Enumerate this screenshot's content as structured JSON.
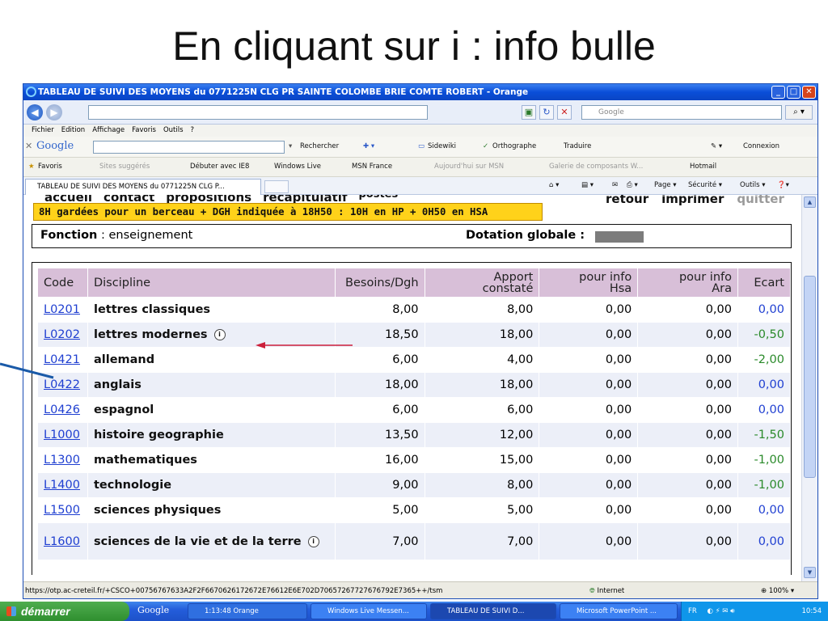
{
  "slide": {
    "title": "En cliquant sur i : info bulle"
  },
  "window": {
    "title": "TABLEAU DE SUIVI DES MOYENS du 0771225N CLG PR SAINTE COLOMBE BRIE COMTE ROBERT - Orange",
    "url": "",
    "search_placeholder": "Google"
  },
  "menubar": [
    "Fichier",
    "Edition",
    "Affichage",
    "Favoris",
    "Outils",
    "?"
  ],
  "google_toolbar": {
    "logo": "Google",
    "rechercher": "Rechercher",
    "sidewiki": "Sidewiki",
    "orthographe": "Orthographe",
    "traduire": "Traduire",
    "connexion": "Connexion"
  },
  "favorites": {
    "favoris": "Favoris",
    "items": [
      "Sites suggérés",
      "Débuter avec IE8",
      "Windows Live",
      "MSN France",
      "Aujourd'hui sur MSN",
      "Galerie de composants W...",
      "Hotmail"
    ]
  },
  "tab": {
    "title": "TABLEAU DE SUIVI DES MOYENS du 0771225N CLG P...",
    "page_menu": "Page",
    "securite_menu": "Sécurité",
    "outils_menu": "Outils"
  },
  "app": {
    "nav": [
      "accueil",
      "contact",
      "propositions",
      "recapitulatif",
      "postes"
    ],
    "retour": "retour",
    "imprimer": "imprimer",
    "quitter": "quitter",
    "highlight": "8H gardées pour un berceau + DGH indiquée à 18H50 : 10H en HP + 0H50 en HSA",
    "fonction_label": "Fonction",
    "fonction_value": " : enseignement",
    "dotation_label": "Dotation globale :"
  },
  "table": {
    "headers": {
      "code": "Code",
      "discipline": "Discipline",
      "besoins": "Besoins/Dgh",
      "apport1": "Apport",
      "apport2": "constaté",
      "hsa1": "pour info",
      "hsa2": "Hsa",
      "ara1": "pour info",
      "ara2": "Ara",
      "ecart": "Ecart"
    },
    "rows": [
      {
        "code": "L0201",
        "discipline": "lettres classiques",
        "besoins": "8,00",
        "apport": "8,00",
        "hsa": "0,00",
        "ara": "0,00",
        "ecart": "0,00",
        "ecart_color": "#1f3fd1",
        "info": false
      },
      {
        "code": "L0202",
        "discipline": "lettres modernes",
        "besoins": "18,50",
        "apport": "18,00",
        "hsa": "0,00",
        "ara": "0,00",
        "ecart": "-0,50",
        "ecart_color": "#2a8a2a",
        "info": true
      },
      {
        "code": "L0421",
        "discipline": "allemand",
        "besoins": "6,00",
        "apport": "4,00",
        "hsa": "0,00",
        "ara": "0,00",
        "ecart": "-2,00",
        "ecart_color": "#2a8a2a",
        "info": false
      },
      {
        "code": "L0422",
        "discipline": "anglais",
        "besoins": "18,00",
        "apport": "18,00",
        "hsa": "0,00",
        "ara": "0,00",
        "ecart": "0,00",
        "ecart_color": "#1f3fd1",
        "info": false
      },
      {
        "code": "L0426",
        "discipline": "espagnol",
        "besoins": "6,00",
        "apport": "6,00",
        "hsa": "0,00",
        "ara": "0,00",
        "ecart": "0,00",
        "ecart_color": "#1f3fd1",
        "info": false
      },
      {
        "code": "L1000",
        "discipline": "histoire geographie",
        "besoins": "13,50",
        "apport": "12,00",
        "hsa": "0,00",
        "ara": "0,00",
        "ecart": "-1,50",
        "ecart_color": "#2a8a2a",
        "info": false
      },
      {
        "code": "L1300",
        "discipline": "mathematiques",
        "besoins": "16,00",
        "apport": "15,00",
        "hsa": "0,00",
        "ara": "0,00",
        "ecart": "-1,00",
        "ecart_color": "#2a8a2a",
        "info": false
      },
      {
        "code": "L1400",
        "discipline": "technologie",
        "besoins": "9,00",
        "apport": "8,00",
        "hsa": "0,00",
        "ara": "0,00",
        "ecart": "-1,00",
        "ecart_color": "#2a8a2a",
        "info": false
      },
      {
        "code": "L1500",
        "discipline": "sciences physiques",
        "besoins": "5,00",
        "apport": "5,00",
        "hsa": "0,00",
        "ara": "0,00",
        "ecart": "0,00",
        "ecart_color": "#1f3fd1",
        "info": false
      },
      {
        "code": "L1600",
        "discipline": "sciences de la vie et de la terre",
        "besoins": "7,00",
        "apport": "7,00",
        "hsa": "0,00",
        "ara": "0,00",
        "ecart": "0,00",
        "ecart_color": "#1f3fd1",
        "info": true
      }
    ]
  },
  "statusbar": {
    "url": "https://otp.ac-creteil.fr/+CSCO+00756767633A2F2F6670626172672E76612E6E702D70657267727676792E7365++/tsm",
    "zone": "Internet",
    "zoom": "100%"
  },
  "taskbar": {
    "start": "démarrer",
    "google": "Google",
    "tasks": [
      "1:13:48 Orange",
      "Windows Live Messen...",
      "TABLEAU DE SUIVI D...",
      "Microsoft PowerPoint ..."
    ],
    "lang": "FR",
    "clock": "10:54"
  },
  "colors": {
    "header_bg": "#d8bfd8",
    "highlight_bg": "#ffd21a",
    "link": "#1f3fd1",
    "ecart_negative": "#2a8a2a",
    "annotation_arrow": "#1a5aa8",
    "annotation_arrow_red": "#cc1f3a"
  }
}
